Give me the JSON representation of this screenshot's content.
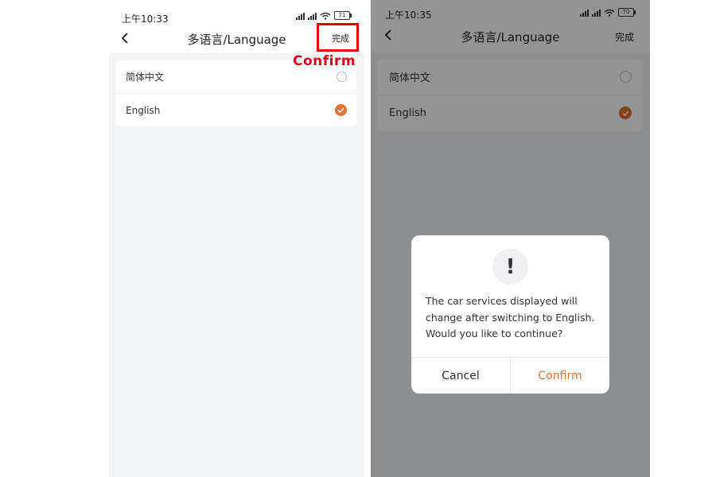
{
  "left_screen": {
    "status_bar": {
      "time": "上午10:33",
      "battery": "71"
    },
    "nav": {
      "title": "多语言/Language",
      "done_label": "完成"
    },
    "languages": [
      {
        "label": "简体中文",
        "selected": false
      },
      {
        "label": "English",
        "selected": true
      }
    ],
    "annotation": {
      "text": "Confirm",
      "color": "#e0001b"
    }
  },
  "right_screen": {
    "status_bar": {
      "time": "上午10:35",
      "battery": "70"
    },
    "nav": {
      "title": "多语言/Language",
      "done_label": "完成"
    },
    "languages": [
      {
        "label": "简体中文",
        "selected": false
      },
      {
        "label": "English",
        "selected": true
      }
    ],
    "dialog": {
      "icon": "!",
      "message": "The car services displayed will change after switching to English. Would you like to continue?",
      "cancel_label": "Cancel",
      "confirm_label": "Confirm"
    }
  },
  "colors": {
    "accent": "#e4712d",
    "annotation_red": "#e00000"
  },
  "icons": [
    "chevron-left-icon",
    "signal-icon",
    "wifi-icon",
    "battery-icon",
    "check-icon",
    "exclamation-icon"
  ]
}
